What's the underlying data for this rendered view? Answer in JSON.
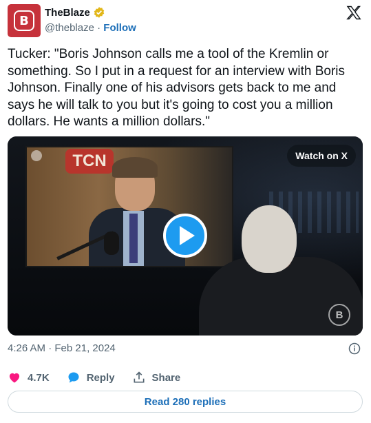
{
  "author": {
    "name": "TheBlaze",
    "handle": "@theblaze",
    "separator": "·",
    "follow_label": "Follow",
    "avatar_text": "B",
    "brand_color": "#c6323b",
    "verified_icon": "gold-verified-badge-icon"
  },
  "tweet": {
    "text": "Tucker: \"Boris Johnson calls me a tool of the Kremlin or something. So I put in a request for an interview with Boris Johnson. Finally one of his advisors gets back to me and says he will talk to you but it's going to cost you a million dollars. He wants a million dollars.\"",
    "timestamp": "4:26 AM · Feb 21, 2024"
  },
  "media": {
    "watch_label": "Watch on X",
    "screen_sign": "TCN",
    "play_icon": "play-icon",
    "corner_logo": "B"
  },
  "actions": {
    "like_count": "4.7K",
    "reply_label": "Reply",
    "share_label": "Share",
    "like_color": "#f91880",
    "reply_color": "#1d9bf0"
  },
  "footer": {
    "read_replies_label": "Read 280 replies"
  }
}
